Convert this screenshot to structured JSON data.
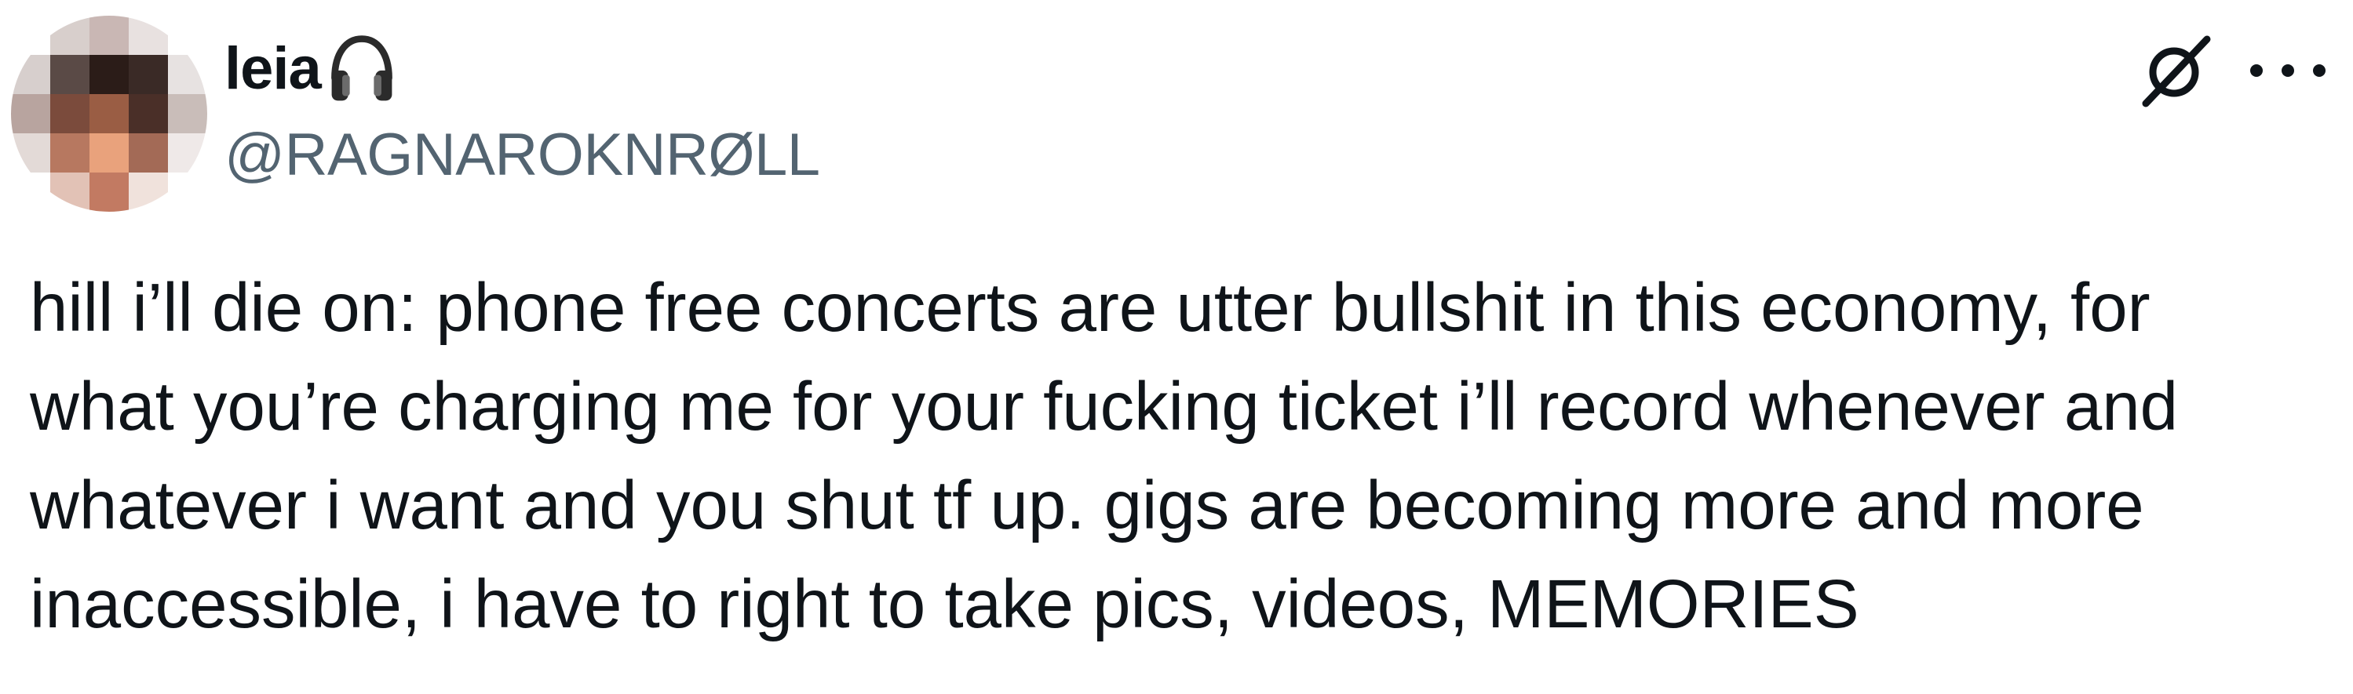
{
  "author": {
    "display_name": "leia",
    "badge_icon": "headphones-icon",
    "handle": "@RAGNAROKNRØLL",
    "avatar": "pixelated-avatar"
  },
  "actions": {
    "grok_icon": "grok-icon",
    "more_icon": "more-icon"
  },
  "tweet": {
    "text": "hill i’ll die on: phone free concerts are utter bullshit in this economy, for\nwhat you’re charging me for your fucking ticket i’ll record whenever and\nwhatever i want and you shut tf up. gigs are becoming more and more\ninaccessible, i have to right to take pics, videos, MEMORIES"
  },
  "colors": {
    "text": "#0f1419",
    "secondary": "#536471",
    "background": "#ffffff"
  }
}
